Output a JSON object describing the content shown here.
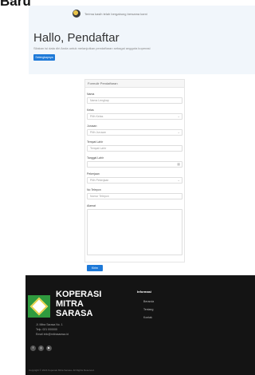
{
  "header_title": "Baru",
  "banner": {
    "text": "Terima kasih telah bergabung bersama kami"
  },
  "hero": {
    "title": "Hallo, Pendaftar",
    "subtitle": "Silakan isi data diri Anda untuk melanjutkan pendaftaran sebagai anggota koperasi",
    "button_label": "Selengkapnya"
  },
  "form": {
    "header": "Formulir Pendaftaran",
    "fields": [
      {
        "label": "Nama",
        "placeholder": "Nama Lengkap"
      },
      {
        "label": "Kelas",
        "placeholder": "Pilih Kelas"
      },
      {
        "label": "Jurusan",
        "placeholder": "Pilih Jurusan"
      },
      {
        "label": "Tempat Lahir",
        "placeholder": "Tempat Lahir"
      },
      {
        "label": "Tanggal Lahir",
        "placeholder": ""
      },
      {
        "label": "Pekerjaan",
        "placeholder": "Pilih Pekerjaan"
      },
      {
        "label": "No Telepon",
        "placeholder": "Nomor Telepon"
      },
      {
        "label": "Alamat",
        "placeholder": ""
      }
    ],
    "submit_label": "Kirim"
  },
  "footer": {
    "brand": [
      "KOPERASI",
      "MITRA",
      "SARASA"
    ],
    "info_title": "Informasi",
    "links": [
      "Beranda",
      "Tentang",
      "Kontak"
    ],
    "address_lines": [
      "Jl. Mitra Sarasa No. 1",
      "Telp. 021 000000",
      "Email info@mitrasarasa.id"
    ],
    "copyright": "Copyright © 2024 Koperasi Mitra Sarasa. All Rights Reserved."
  },
  "colors": {
    "accent": "#1d79d8",
    "footer_bg": "#141414",
    "logo_green": "#2f9a3e"
  }
}
